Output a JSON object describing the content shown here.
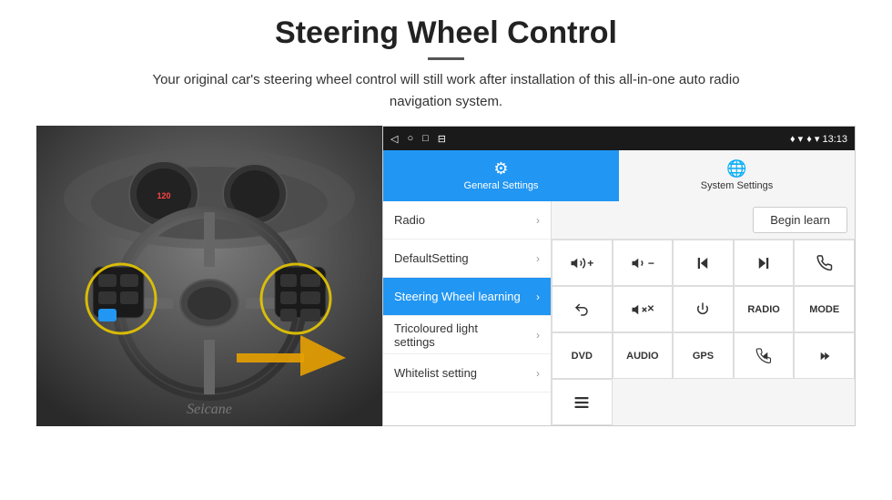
{
  "header": {
    "title": "Steering Wheel Control",
    "subtitle": "Your original car's steering wheel control will still work after installation of this all-in-one auto radio navigation system.",
    "divider": true
  },
  "status_bar": {
    "nav_buttons": [
      "◁",
      "○",
      "□",
      "⊟"
    ],
    "right": "♦ ▾  13:13"
  },
  "tabs": [
    {
      "label": "General Settings",
      "icon": "⚙",
      "active": true
    },
    {
      "label": "System Settings",
      "icon": "🌐",
      "active": false
    }
  ],
  "menu_items": [
    {
      "label": "Radio",
      "active": false
    },
    {
      "label": "DefaultSetting",
      "active": false
    },
    {
      "label": "Steering Wheel learning",
      "active": true
    },
    {
      "label": "Tricoloured light settings",
      "active": false
    },
    {
      "label": "Whitelist setting",
      "active": false
    }
  ],
  "begin_learn_btn": "Begin learn",
  "controls": [
    {
      "symbol": "🔊+",
      "type": "vol-up"
    },
    {
      "symbol": "🔊−",
      "type": "vol-down"
    },
    {
      "symbol": "⏮",
      "type": "prev"
    },
    {
      "symbol": "⏭",
      "type": "next"
    },
    {
      "symbol": "📞",
      "type": "call"
    },
    {
      "symbol": "↩",
      "type": "back"
    },
    {
      "symbol": "🔊✕",
      "type": "mute"
    },
    {
      "symbol": "⏻",
      "type": "power"
    },
    {
      "symbol": "RADIO",
      "type": "radio"
    },
    {
      "symbol": "MODE",
      "type": "mode"
    },
    {
      "symbol": "DVD",
      "type": "dvd"
    },
    {
      "symbol": "AUDIO",
      "type": "audio"
    },
    {
      "symbol": "GPS",
      "type": "gps"
    },
    {
      "symbol": "📞⏮",
      "type": "call-prev"
    },
    {
      "symbol": "⏮⏭",
      "type": "call-next"
    },
    {
      "symbol": "≡",
      "type": "menu-icon"
    }
  ]
}
